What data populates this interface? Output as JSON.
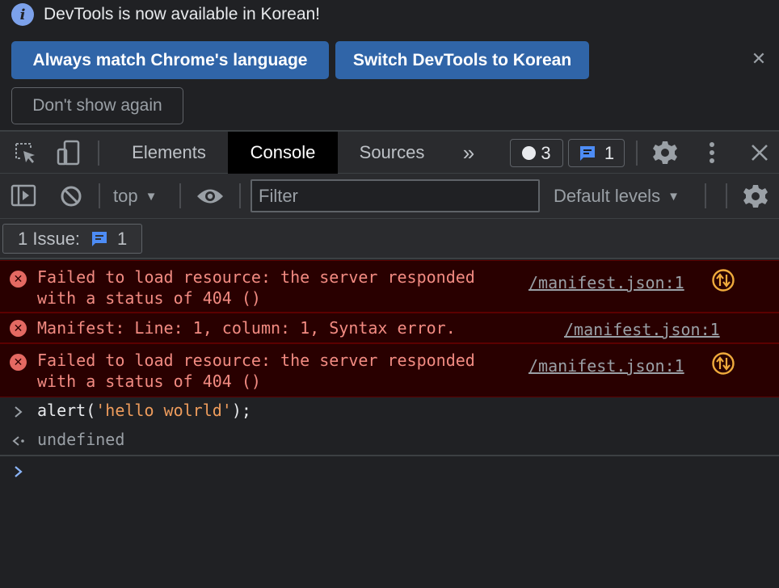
{
  "infobar": {
    "message": "DevTools is now available in Korean!",
    "icon": "info-icon",
    "always_match_label": "Always match Chrome's language",
    "switch_label": "Switch DevTools to Korean",
    "dont_show_label": "Don't show again",
    "close_icon": "close-icon"
  },
  "toolbar": {
    "tabs": [
      {
        "label": "Elements",
        "active": false
      },
      {
        "label": "Console",
        "active": true
      },
      {
        "label": "Sources",
        "active": false
      }
    ],
    "more_tabs": "»",
    "errors_count": "3",
    "messages_count": "1",
    "icons": [
      "inspect-element-icon",
      "device-toolbar-icon",
      "chevron-double-right-icon",
      "gear-icon",
      "kebab-menu-icon",
      "close-icon"
    ]
  },
  "console_toolbar": {
    "context": "top",
    "filter_placeholder": "Filter",
    "levels": "Default levels",
    "icons": [
      "sidebar-toggle-icon",
      "clear-console-icon",
      "eye-icon",
      "gear-icon"
    ]
  },
  "issues": {
    "label": "1 Issue:",
    "count": "1"
  },
  "messages": [
    {
      "type": "error",
      "text": "Failed to load resource: the server responded\nwith a status of 404 ()",
      "source": "/manifest.json:1",
      "network_icon": true
    },
    {
      "type": "error",
      "text": "Manifest: Line: 1, column: 1, Syntax error.",
      "source": "/manifest.json:1",
      "network_icon": false
    },
    {
      "type": "error",
      "text": "Failed to load resource: the server responded\nwith a status of 404 ()",
      "source": "/manifest.json:1",
      "network_icon": true
    }
  ],
  "repl": {
    "input_prefix": "alert(",
    "input_string": "'hello wolrld'",
    "input_suffix": ");",
    "result": "undefined"
  },
  "colors": {
    "background": "#202124",
    "toolbar": "#2a2b2e",
    "button_blue": "#3065a8",
    "error_bg": "#290000",
    "error_text": "#f28b82",
    "link_blue": "#8ab4f8",
    "string_orange": "#ee9c5c",
    "network_orange": "#f0ab3c"
  }
}
